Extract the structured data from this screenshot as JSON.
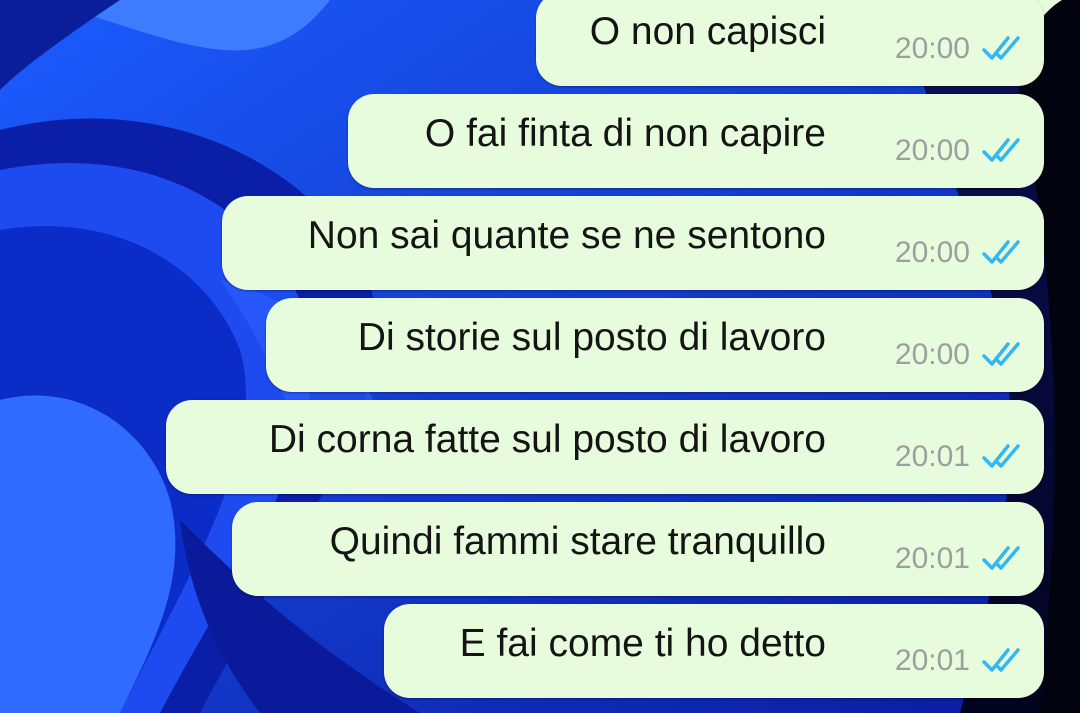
{
  "chat": {
    "messages": [
      {
        "text": "O non capisci",
        "time": "20:00",
        "status": "read"
      },
      {
        "text": "O fai finta di non capire",
        "time": "20:00",
        "status": "read"
      },
      {
        "text": "Non sai quante se ne sentono",
        "time": "20:00",
        "status": "read"
      },
      {
        "text": "Di storie sul posto di lavoro",
        "time": "20:00",
        "status": "read"
      },
      {
        "text": "Di corna fatte sul posto di lavoro",
        "time": "20:01",
        "status": "read"
      },
      {
        "text": "Quindi fammi stare tranquillo",
        "time": "20:01",
        "status": "read"
      },
      {
        "text": "E fai come ti ho detto",
        "time": "20:01",
        "status": "read"
      }
    ]
  },
  "colors": {
    "bubble": "#e7fcdc",
    "text": "#141414",
    "time": "#9aa0a0",
    "read_ticks": "#34b7f1",
    "wallpaper": "#0d2bd8"
  },
  "icons": {
    "status": "double-check-icon"
  }
}
